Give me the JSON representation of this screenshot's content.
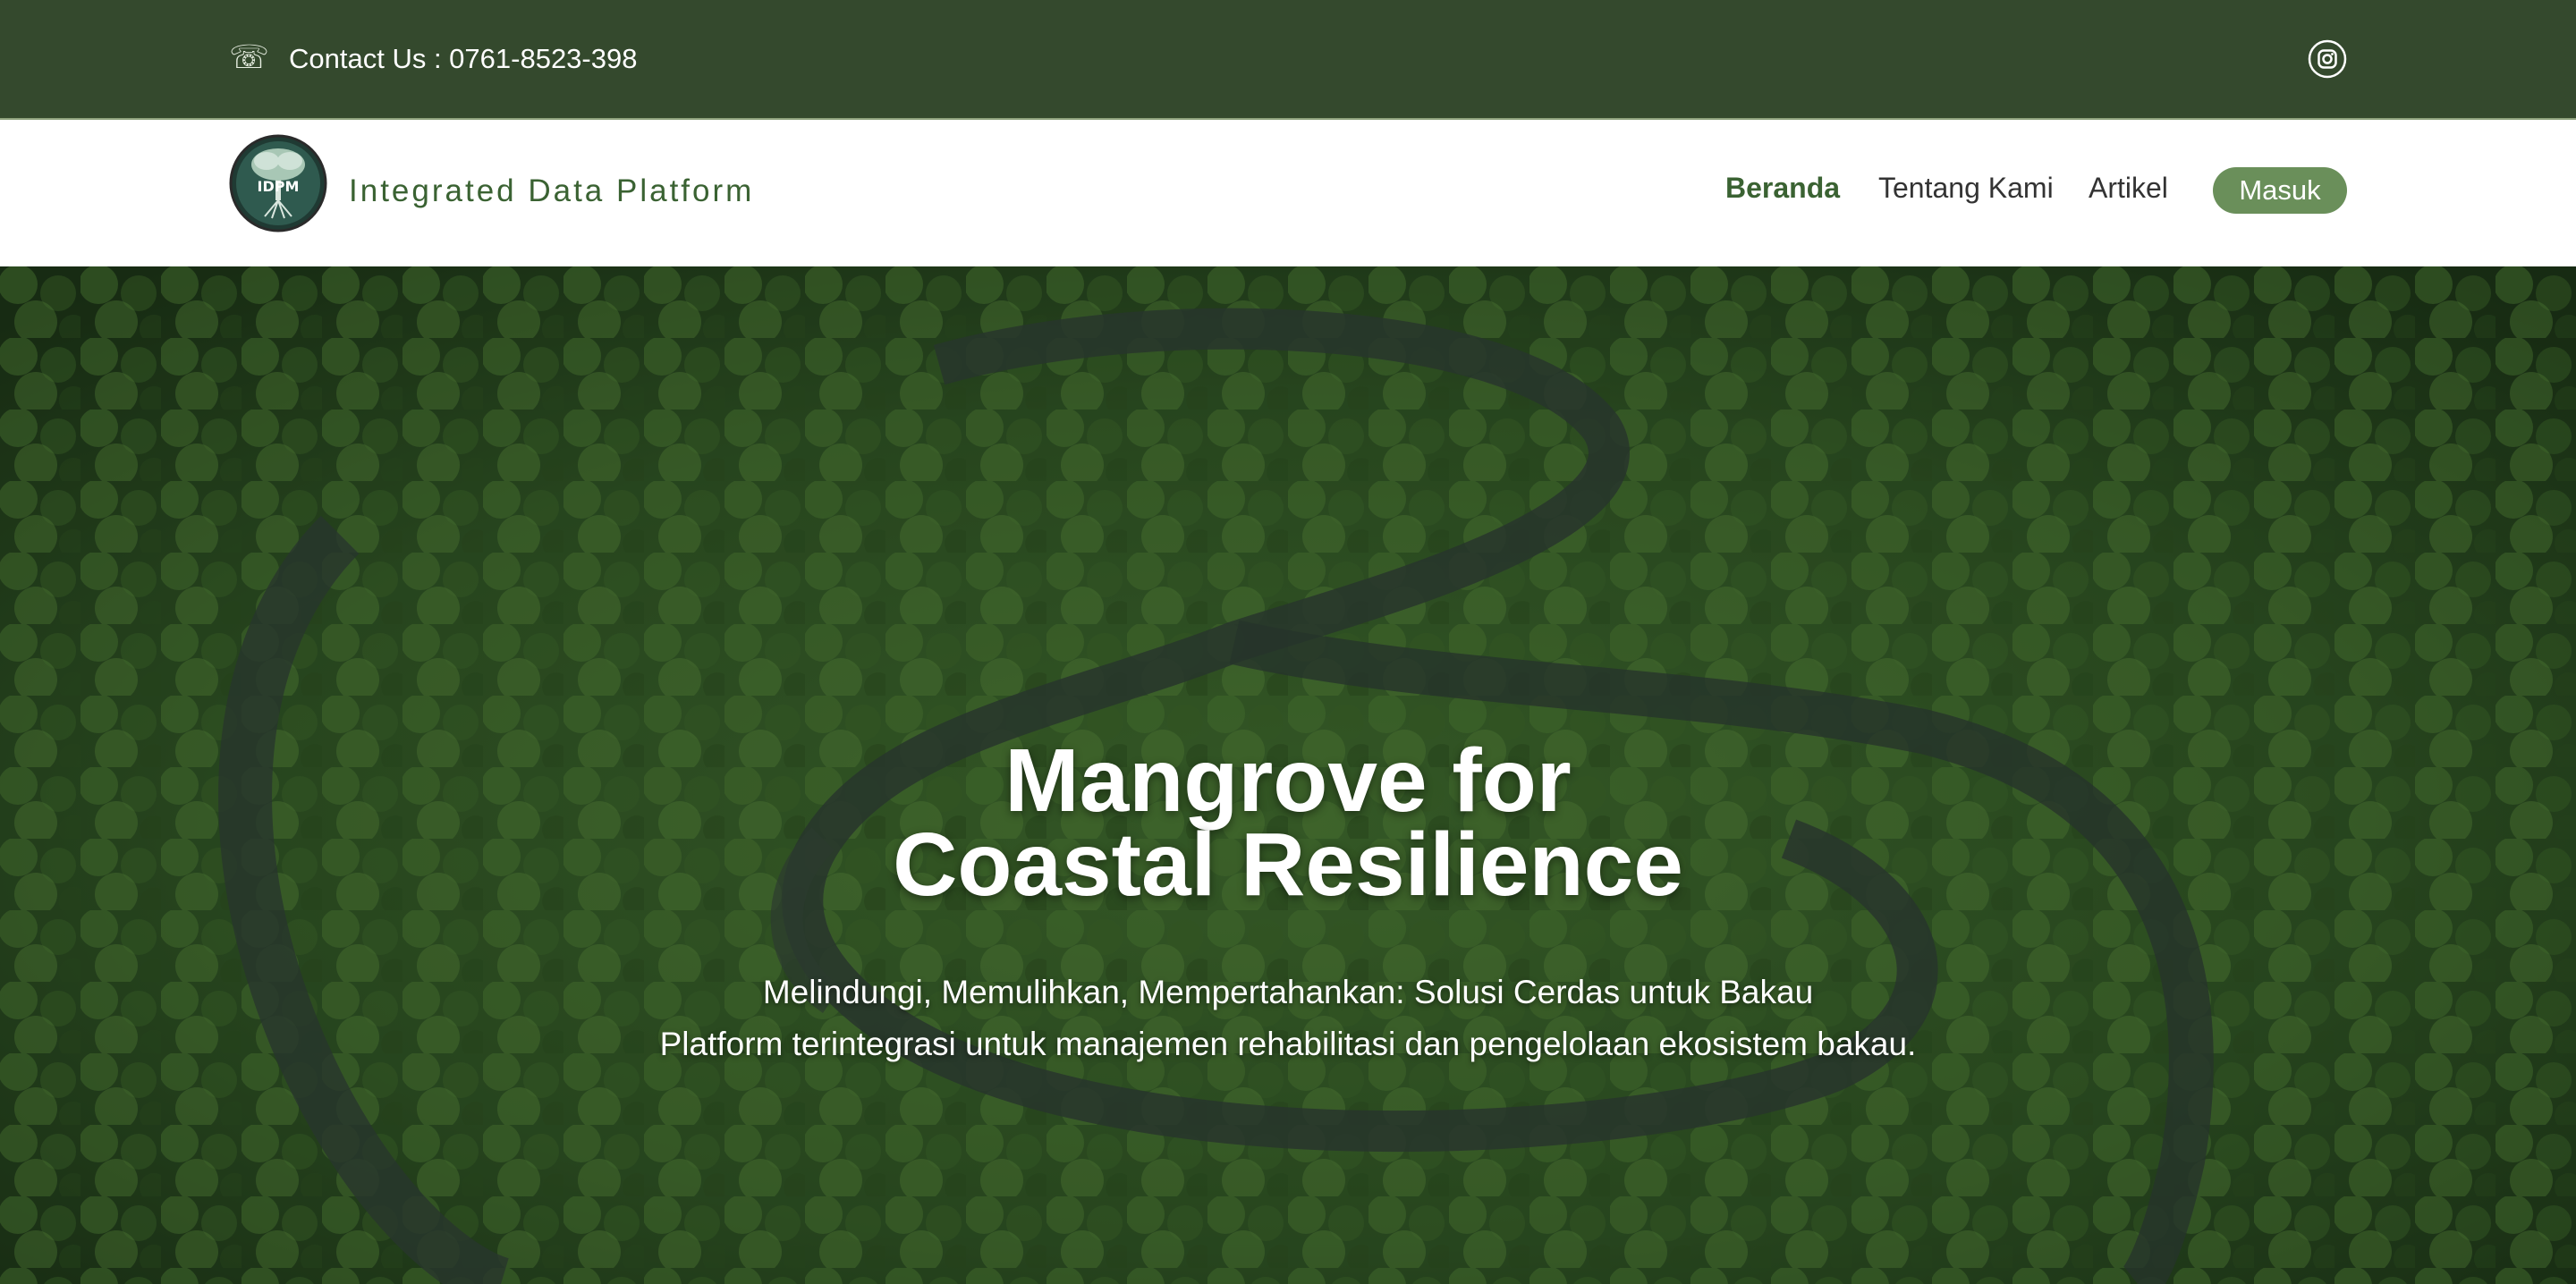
{
  "topbar": {
    "contact_text": "Contact Us : 0761-8523-398",
    "phone_icon": "phone-icon",
    "social_icon": "instagram-icon"
  },
  "navbar": {
    "brand_name": "Integrated Data Platform",
    "logo_text": "IDPM",
    "items": [
      {
        "label": "Beranda",
        "active": true
      },
      {
        "label": "Tentang Kami",
        "active": false
      },
      {
        "label": "Artikel",
        "active": false
      }
    ],
    "login_button": "Masuk"
  },
  "hero": {
    "title_line1": "Mangrove for",
    "title_line2": "Coastal Resilience",
    "subtitle1": "Melindungi, Memulihkan, Mempertahankan: Solusi Cerdas untuk Bakau",
    "subtitle2": "Platform terintegrasi untuk manajemen rehabilitasi dan pengelolaan ekosistem bakau."
  },
  "colors": {
    "topbar_bg": "#34492d",
    "brand_green": "#3a6232",
    "button_green": "#6a8f5a"
  }
}
